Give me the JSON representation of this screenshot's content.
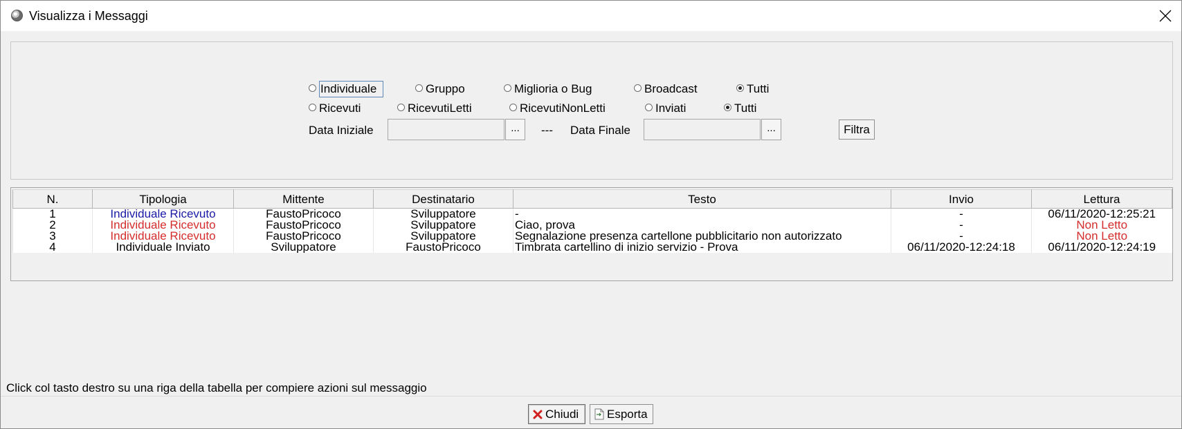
{
  "window": {
    "title": "Visualizza i Messaggi"
  },
  "filters": {
    "tipologia": {
      "options": [
        "Individuale",
        "Gruppo",
        "Miglioria o Bug",
        "Broadcast",
        "Tutti"
      ],
      "selected": "Tutti",
      "focused": "Individuale"
    },
    "direzione": {
      "options": [
        "Ricevuti",
        "RicevutiLetti",
        "RicevutiNonLetti",
        "Inviati",
        "Tutti"
      ],
      "selected": "Tutti"
    },
    "data_iniziale_label": "Data Iniziale",
    "data_iniziale_value": "",
    "separator": "---",
    "data_finale_label": "Data Finale",
    "data_finale_value": "",
    "dots_label": "...",
    "filtra_label": "Filtra"
  },
  "table": {
    "columns": [
      "N.",
      "Tipologia",
      "Mittente",
      "Destinatario",
      "Testo",
      "Invio",
      "Lettura"
    ],
    "rows": [
      {
        "n": "1",
        "tipologia": "Individuale Ricevuto",
        "mittente": "FaustoPricoco",
        "destinatario": "Sviluppatore",
        "testo": "-",
        "invio": "-",
        "lettura": "06/11/2020-12:25:21",
        "tipologia_color": "blue",
        "lettura_color": "black"
      },
      {
        "n": "2",
        "tipologia": "Individuale Ricevuto",
        "mittente": "FaustoPricoco",
        "destinatario": "Sviluppatore",
        "testo": "Ciao, prova",
        "invio": "-",
        "lettura": "Non Letto",
        "tipologia_color": "red",
        "lettura_color": "red"
      },
      {
        "n": "3",
        "tipologia": "Individuale Ricevuto",
        "mittente": "FaustoPricoco",
        "destinatario": "Sviluppatore",
        "testo": "Segnalazione presenza cartellone pubblicitario non autorizzato",
        "invio": "-",
        "lettura": "Non Letto",
        "tipologia_color": "red",
        "lettura_color": "red"
      },
      {
        "n": "4",
        "tipologia": "Individuale Inviato",
        "mittente": "Sviluppatore",
        "destinatario": "FaustoPricoco",
        "testo": "Timbrata cartellino di inizio servizio - Prova",
        "invio": "06/11/2020-12:24:18",
        "lettura": "06/11/2020-12:24:19",
        "tipologia_color": "black",
        "lettura_color": "black"
      }
    ]
  },
  "hint": "Click col tasto destro su una riga della tabella per compiere azioni sul messaggio",
  "buttons": {
    "chiudi_label": "Chiudi",
    "esporta_label": "Esporta"
  },
  "colors": {
    "blue_text": "#1a1aa6",
    "red_text": "#d42c2c",
    "focus_border": "#5a86b8"
  }
}
